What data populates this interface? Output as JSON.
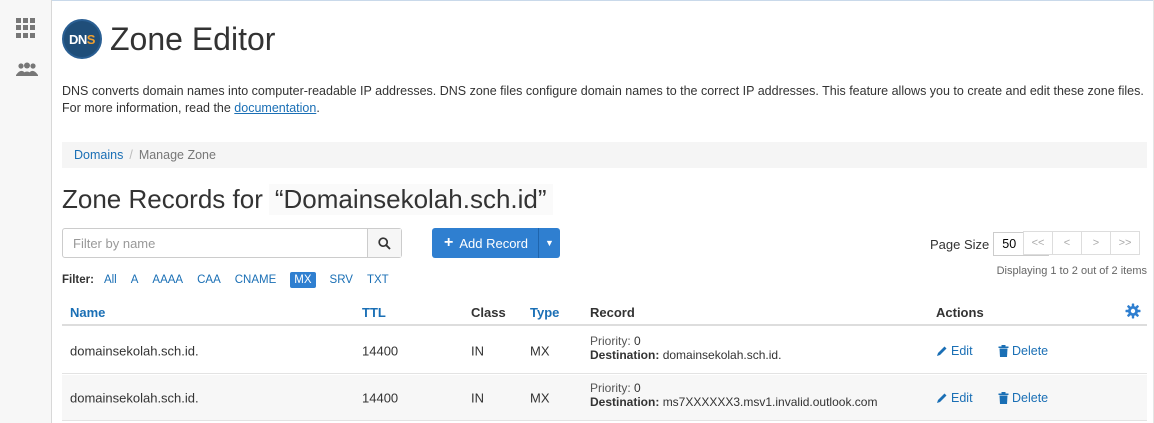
{
  "header": {
    "logo_text_dn": "DN",
    "logo_text_s": "S",
    "title": "Zone Editor"
  },
  "description": {
    "text": "DNS converts domain names into computer-readable IP addresses. DNS zone files configure domain names to the correct IP addresses. This feature allows you to create and edit these zone files. For more information, read the ",
    "link": "documentation",
    "tail": "."
  },
  "breadcrumb": {
    "root": "Domains",
    "separator": "/",
    "current": "Manage Zone"
  },
  "section": {
    "title": "Zone Records for",
    "domain": "“Domainsekolah.sch.id”"
  },
  "toolbar": {
    "filter_placeholder": "Filter by name",
    "add_record_label": "Add Record",
    "page_size_label": "Page Size",
    "page_size_value": "50",
    "pager": [
      "<<",
      "<",
      ">",
      ">>"
    ],
    "displaying": "Displaying 1 to 2 out of 2 items"
  },
  "filters": {
    "label": "Filter:",
    "options": [
      "All",
      "A",
      "AAAA",
      "CAA",
      "CNAME",
      "MX",
      "SRV",
      "TXT"
    ],
    "active": "MX"
  },
  "table": {
    "columns": {
      "name": "Name",
      "ttl": "TTL",
      "class": "Class",
      "type": "Type",
      "record": "Record",
      "actions": "Actions"
    },
    "rows": [
      {
        "name": "domainsekolah.sch.id.",
        "ttl": "14400",
        "class": "IN",
        "type": "MX",
        "priority_label": "Priority:",
        "priority": "0",
        "destination_label": "Destination:",
        "destination": "domainsekolah.sch.id.",
        "edit": "Edit",
        "delete": "Delete"
      },
      {
        "name": "domainsekolah.sch.id.",
        "ttl": "14400",
        "class": "IN",
        "type": "MX",
        "priority_label": "Priority:",
        "priority": "0",
        "destination_label": "Destination:",
        "destination": "ms7XXXXXX3.msv1.invalid.outlook.com",
        "edit": "Edit",
        "delete": "Delete"
      }
    ]
  },
  "colors": {
    "primary": "#2f7fd0",
    "link": "#1a6fb5",
    "logo_bg": "#1f4e79"
  }
}
